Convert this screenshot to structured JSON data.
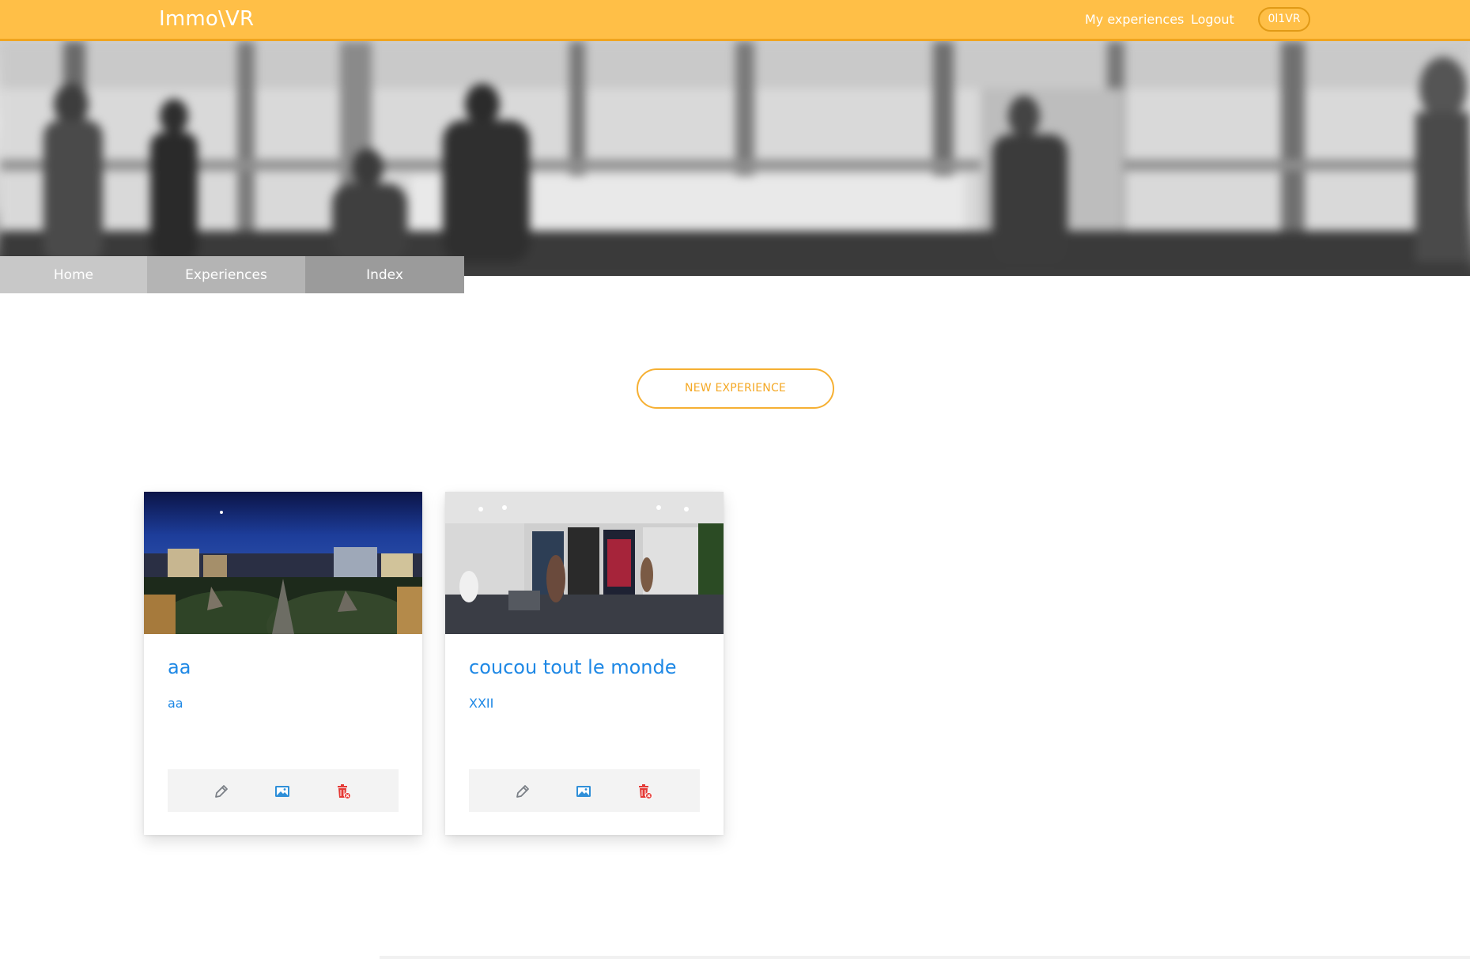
{
  "header": {
    "brand": "Immo\\VR",
    "links": {
      "my_experiences": "My experiences",
      "logout": "Logout"
    },
    "user_pill": "0l1VR",
    "bar_color": "#ffbf47"
  },
  "breadcrumb": {
    "home": "Home",
    "experiences": "Experiences",
    "index": "Index"
  },
  "actions": {
    "new_experience": "NEW EXPERIENCE"
  },
  "experiences": [
    {
      "title": "aa",
      "subtitle": "aa",
      "thumbnail": "night-city-panorama"
    },
    {
      "title": "coucou tout le monde",
      "subtitle": "XXII",
      "thumbnail": "office-panorama"
    }
  ],
  "card_actions": {
    "edit_icon": "pencil-icon",
    "media_icon": "image-icon",
    "delete_icon": "trash-icon"
  },
  "colors": {
    "accent": "#f4a825",
    "link_blue": "#1e88e5",
    "danger": "#e53935"
  }
}
